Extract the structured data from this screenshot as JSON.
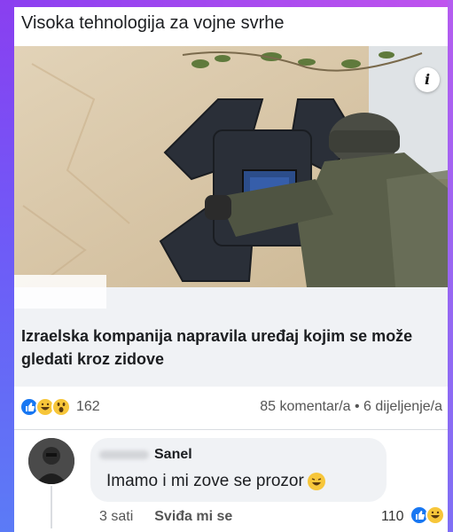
{
  "post": {
    "text": "Visoka tehnologija za vojne svrhe"
  },
  "link_preview": {
    "title": "Izraelska kompanija napravila uređaj kojim se može gledati kroz zidove",
    "info_icon_label": "i"
  },
  "reactions": {
    "icons": [
      "like-icon",
      "haha-icon",
      "wow-icon"
    ],
    "count": "162",
    "stats": "85 komentar/a • 6 dijeljenje/a"
  },
  "comment": {
    "author": "Sanel",
    "text": "Imamo i mi zove se prozor",
    "time": "3 sati",
    "like_label": "Sviđa mi se",
    "reaction_count": "110"
  },
  "colors": {
    "frame_purple": "#8a3ff0",
    "facebook_blue": "#1877f2",
    "bubble_grey": "#f0f2f5"
  }
}
